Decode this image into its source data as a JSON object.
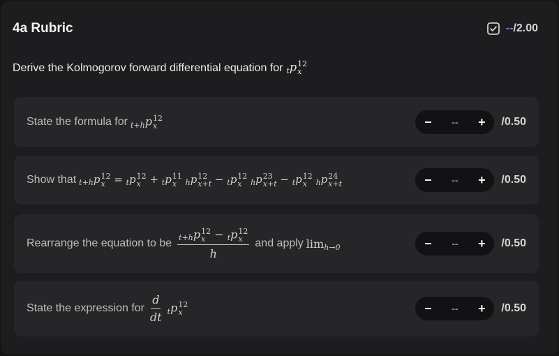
{
  "header": {
    "title": "4a Rubric",
    "score_dash": "--",
    "score_max": "/2.00",
    "check_icon": "checkbox-check-icon"
  },
  "question": {
    "text": "Derive the Kolmogorov forward differential equation for",
    "math_sub": "t",
    "math_base": "p",
    "math_sup": "12",
    "math_subx": "x"
  },
  "criteria": [
    {
      "text": "State the formula for",
      "math": "t+h p x 12",
      "value": "--",
      "max": "/0.50"
    },
    {
      "text": "Show that",
      "math": "t+h p x 12 = t p x 12 + t p x 11 h p x+t 12 − t p x 12 h p x+t 23 − t p x 12 h p x+t 24",
      "value": "--",
      "max": "/0.50"
    },
    {
      "text": "Rearrange the equation to be",
      "frac_num": "t+h p x 12 − t p x 12",
      "frac_den": "h",
      "text2": "and apply",
      "lim": "lim h→0",
      "value": "--",
      "max": "/0.50"
    },
    {
      "text": "State the expression for",
      "frac_num": "d",
      "frac_den": "dt",
      "math": "t p x 12",
      "value": "--",
      "max": "/0.50"
    }
  ],
  "stepper": {
    "minus": "−",
    "plus": "+"
  },
  "colors": {
    "accent": "#8b86c9",
    "card": "#262628",
    "panel": "#1d1d1f"
  }
}
